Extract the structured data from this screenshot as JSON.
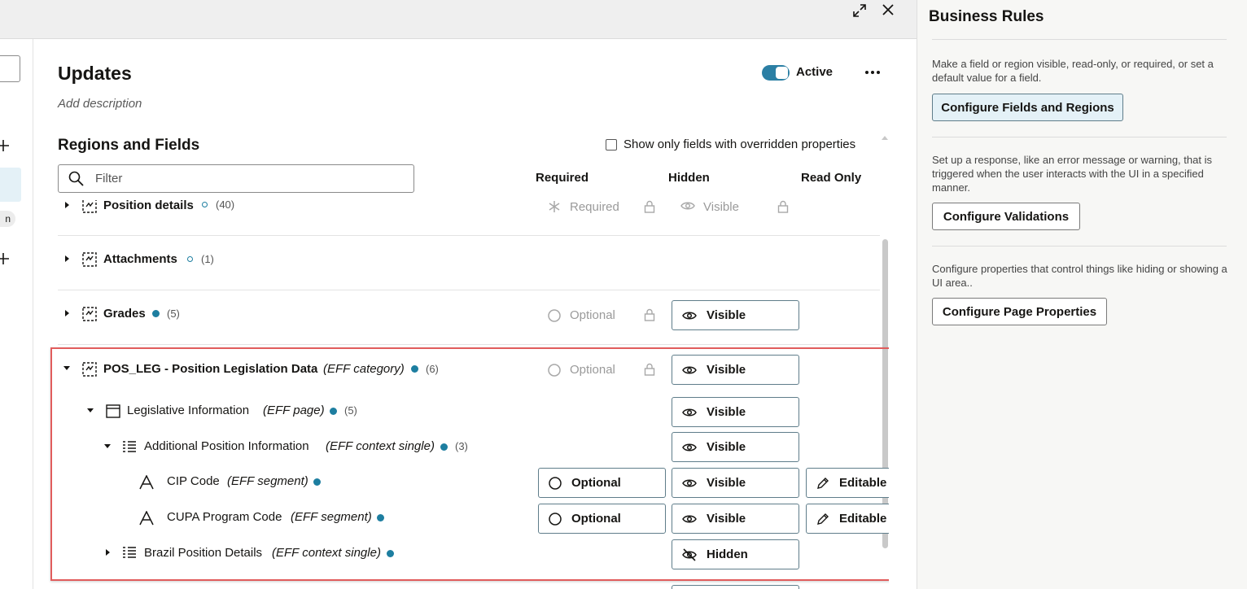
{
  "header": {
    "title": "Updates",
    "description_placeholder": "Add description",
    "active_label": "Active",
    "active": true
  },
  "left_strip": {
    "pill_text": "n"
  },
  "regions": {
    "title": "Regions and Fields",
    "show_overridden_label": "Show only fields with overridden properties",
    "filter_placeholder": "Filter",
    "columns": {
      "required": "Required",
      "hidden": "Hidden",
      "read_only": "Read Only"
    }
  },
  "rows": [
    {
      "name": "Position details",
      "count": "(40)",
      "required": "Required",
      "hidden": "Visible"
    },
    {
      "name": "Attachments",
      "count": "(1)"
    },
    {
      "name": "Grades",
      "count": "(5)",
      "required": "Optional",
      "hidden": "Visible"
    },
    {
      "name": "POS_LEG - Position Legislation Data",
      "type": "(EFF category)",
      "count": "(6)",
      "required": "Optional",
      "hidden": "Visible"
    },
    {
      "name": "Legislative Information",
      "type": "(EFF page)",
      "count": "(5)",
      "hidden": "Visible"
    },
    {
      "name": "Additional Position Information",
      "type": "(EFF context single)",
      "count": "(3)",
      "hidden": "Visible"
    },
    {
      "name": "CIP Code",
      "type": "(EFF segment)",
      "required": "Optional",
      "hidden": "Visible",
      "read_only": "Editable"
    },
    {
      "name": "CUPA Program Code",
      "type": "(EFF segment)",
      "required": "Optional",
      "hidden": "Visible",
      "read_only": "Editable"
    },
    {
      "name": "Brazil Position Details",
      "type": "(EFF context single)",
      "hidden": "Hidden"
    }
  ],
  "business_rules": {
    "title": "Business Rules",
    "sections": [
      {
        "text": "Make a field or region visible, read-only, or required, or set a default value for a field.",
        "button": "Configure Fields and Regions"
      },
      {
        "text": "Set up a response, like an error message or warning, that is triggered when the user interacts with the UI in a specified manner.",
        "button": "Configure Validations"
      },
      {
        "text": "Configure properties that control things like hiding or showing a UI area..",
        "button": "Configure Page Properties"
      }
    ]
  },
  "colors": {
    "accent": "#1d7ea0",
    "toggle": "#2b7fa4",
    "highlight": "#e15c5c",
    "selected_button_bg": "#e4f1f7"
  },
  "icons": [
    "expand-icon",
    "close-icon",
    "more-icon",
    "search-icon",
    "plus-icon",
    "region-icon",
    "page-icon",
    "context-icon",
    "segment-icon",
    "eye-icon",
    "eye-off-icon",
    "optional-circle-icon",
    "lock-icon",
    "asterisk-icon",
    "pencil-icon"
  ]
}
